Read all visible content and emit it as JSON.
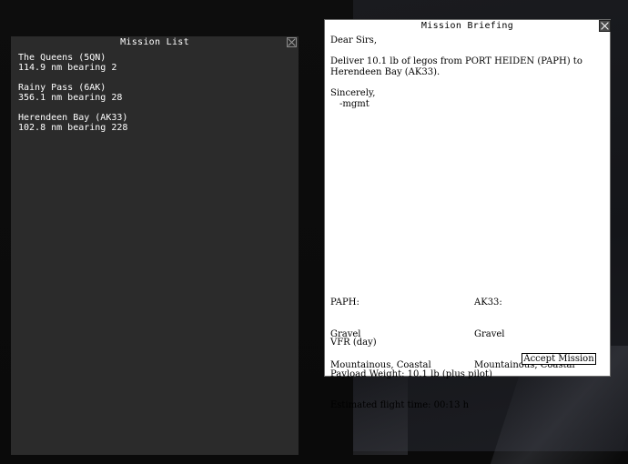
{
  "mission_list": {
    "title": "Mission List",
    "items": [
      {
        "name": "The Queens (5QN)",
        "detail": "114.9 nm bearing 2"
      },
      {
        "name": "Rainy Pass (6AK)",
        "detail": "356.1 nm bearing 28"
      },
      {
        "name": "Herendeen Bay (AK33)",
        "detail": "102.8 nm bearing 228"
      }
    ]
  },
  "briefing": {
    "title": "Mission Briefing",
    "greeting": "Dear Sirs,",
    "body_line1": "Deliver 10.1 lb of legos from PORT HEIDEN (PAPH) to",
    "body_line2": "Herendeen Bay (AK33).",
    "closing": "Sincerely,",
    "signature": "-mgmt",
    "origin": {
      "code": "PAPH:",
      "surface": "Gravel",
      "terrain": "Mountainous, Coastal"
    },
    "destination": {
      "code": "AK33:",
      "surface": "Gravel",
      "terrain": "Mountainous, Coastal"
    },
    "flight_rules": "VFR (day)",
    "payload": "Payload Weight: 10.1 lb (plus pilot)",
    "flight_time": "Estimated flight time: 00:13 h",
    "accept_label": "Accept Mission"
  },
  "colors": {
    "list_bg": "#2b2b2b",
    "briefing_bg": "#ffffff",
    "desktop_bg": "#0a0a0a"
  }
}
